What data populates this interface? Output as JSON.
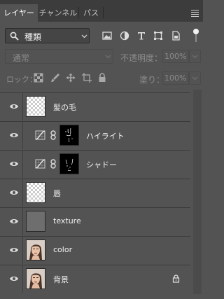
{
  "tabs": [
    {
      "label": "レイヤー",
      "active": true
    },
    {
      "label": "チャンネル",
      "active": false
    },
    {
      "label": "パス",
      "active": false
    }
  ],
  "filter": {
    "kind_label": "種類",
    "icons": [
      "pixel-filter-icon",
      "adjustment-filter-icon",
      "type-filter-icon",
      "shape-filter-icon",
      "smart-object-filter-icon",
      "filter-toggle-icon"
    ]
  },
  "blend": {
    "mode": "通常",
    "opacity_label": "不透明度：",
    "opacity_value": "100%"
  },
  "lock": {
    "label": "ロック：",
    "icons": [
      "lock-transparent-icon",
      "lock-paint-icon",
      "lock-move-icon",
      "lock-artboard-icon",
      "lock-all-icon"
    ],
    "fill_label": "塗り：",
    "fill_value": "100%"
  },
  "layers": [
    {
      "name": "髪の毛",
      "thumb": "transparent",
      "type": "pixel"
    },
    {
      "name": "ハイライト",
      "thumb": "mask",
      "type": "adjustment"
    },
    {
      "name": "シャドー",
      "thumb": "mask",
      "type": "adjustment"
    },
    {
      "name": "唇",
      "thumb": "transparent",
      "type": "pixel"
    },
    {
      "name": "texture",
      "thumb": "gray",
      "type": "pixel"
    },
    {
      "name": "color",
      "thumb": "portrait",
      "type": "pixel"
    },
    {
      "name": "背景",
      "thumb": "portrait",
      "type": "background",
      "locked": true
    }
  ],
  "colors": {
    "panel": "#535353",
    "tabbar": "#3c3c3c"
  }
}
